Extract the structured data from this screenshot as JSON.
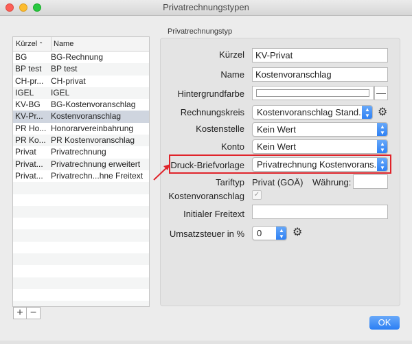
{
  "window": {
    "title": "Privatrechnungstypen"
  },
  "list": {
    "headers": {
      "kuerzel": "Kürzel",
      "name": "Name",
      "sort_indicator": "⌃"
    },
    "rows": [
      {
        "kuerzel": "BG",
        "name": "BG-Rechnung"
      },
      {
        "kuerzel": "BP test",
        "name": "BP test"
      },
      {
        "kuerzel": "CH-pr...",
        "name": "CH-privat"
      },
      {
        "kuerzel": "IGEL",
        "name": "IGEL"
      },
      {
        "kuerzel": "KV-BG",
        "name": "BG-Kostenvoranschlag"
      },
      {
        "kuerzel": "KV-Pr...",
        "name": "Kostenvoranschlag",
        "selected": true
      },
      {
        "kuerzel": "PR Ho...",
        "name": "Honorarvereinbahrung"
      },
      {
        "kuerzel": "PR Ko...",
        "name": "PR Kostenvoranschlag"
      },
      {
        "kuerzel": "Privat",
        "name": "Privatrechnung"
      },
      {
        "kuerzel": "Privat...",
        "name": "Privatrechnung erweitert"
      },
      {
        "kuerzel": "Privat...",
        "name": "Privatrechn...hne Freitext"
      }
    ],
    "empty_rows": 11,
    "add_label": "+",
    "remove_label": "−"
  },
  "form": {
    "group_title": "Privatrechnungstyp",
    "kuerzel": {
      "label": "Kürzel",
      "value": "KV-Privat"
    },
    "name": {
      "label": "Name",
      "value": "Kostenvoranschlag"
    },
    "hintergrundfarbe": {
      "label": "Hintergrundfarbe",
      "clear_label": "—"
    },
    "rechnungskreis": {
      "label": "Rechnungskreis",
      "value": "Kostenvoranschlag Stand..."
    },
    "kostenstelle": {
      "label": "Kostenstelle",
      "value": "Kein Wert"
    },
    "konto": {
      "label": "Konto",
      "value": "Kein Wert"
    },
    "druck_briefvorlage": {
      "label": "Druck-Briefvorlage",
      "value": "Privatrechnung Kostenvorans..."
    },
    "tariftyp": {
      "label": "Tariftyp",
      "value": "Privat (GOÄ)"
    },
    "waehrung": {
      "label": "Währung:",
      "value": ""
    },
    "kostenvoranschlag": {
      "label": "Kostenvoranschlag",
      "checked": true,
      "check_glyph": "✓"
    },
    "initialer_freitext": {
      "label": "Initialer Freitext",
      "value": ""
    },
    "umsatzsteuer": {
      "label": "Umsatzsteuer in %",
      "value": "0"
    }
  },
  "buttons": {
    "ok": "OK"
  },
  "icons": {
    "gear": "⚙",
    "stepper_up": "▲",
    "stepper_down": "▼"
  },
  "colors": {
    "accent": "#2a7ef4",
    "highlight": "#e0232a",
    "selected_row": "#cfd5df"
  }
}
